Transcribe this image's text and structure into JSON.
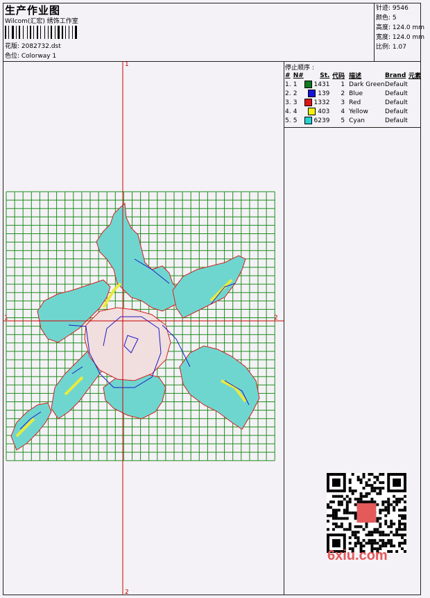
{
  "header": {
    "title": "生产作业图",
    "company": "Wilcom(汇宏) 绣饰工作室",
    "file_label": "花版: 2082732.dst",
    "colorway_label": "色位: Colorway 1"
  },
  "specs": {
    "stitches": "针迹: 9546",
    "colors": "颜色: 5",
    "height": "高度: 124.0 mm",
    "width": "宽度: 124.0 mm",
    "scale": "比例: 1.07"
  },
  "stop_sequence": {
    "title": "停止顺序 :",
    "headers": [
      "#",
      "N#",
      "St.",
      "代码",
      "描述",
      "Brand",
      "元素"
    ],
    "rows": [
      {
        "num": "1.",
        "n": "1",
        "st": "1431",
        "code": "1",
        "desc": "Dark Green",
        "brand": "Default",
        "color": "#0f7a1e"
      },
      {
        "num": "2.",
        "n": "2",
        "st": "139",
        "code": "2",
        "desc": "Blue",
        "brand": "Default",
        "color": "#1414d8"
      },
      {
        "num": "3.",
        "n": "3",
        "st": "1332",
        "code": "3",
        "desc": "Red",
        "brand": "Default",
        "color": "#e01414"
      },
      {
        "num": "4.",
        "n": "4",
        "st": "403",
        "code": "4",
        "desc": "Yellow",
        "brand": "Default",
        "color": "#f2f20a"
      },
      {
        "num": "5.",
        "n": "5",
        "st": "6239",
        "code": "5",
        "desc": "Cyan",
        "brand": "Default",
        "color": "#28d2d2"
      }
    ]
  },
  "axis_labels": {
    "top": "1",
    "bottom": "2",
    "left": "1",
    "right": "2"
  },
  "watermark": {
    "site": "6xiu.com"
  },
  "colors": {
    "grid": "#1e8c1e",
    "axis": "#cc0000",
    "fill": "#6fd6cf",
    "outline": "#d42020",
    "stitch": "#1a1ac8",
    "yellow": "#eaea3a"
  }
}
